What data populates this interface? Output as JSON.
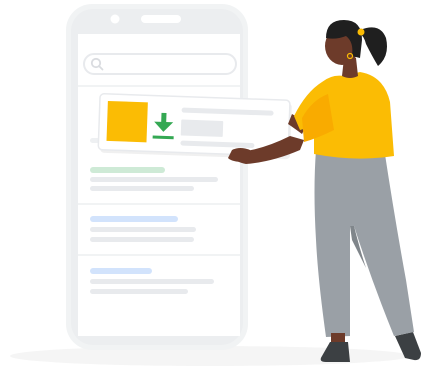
{
  "scene": {
    "kind": "illustration",
    "palette": {
      "background": "#ffffff",
      "phone_body": "#f1f3f4",
      "phone_frame": "#e8eaed",
      "phone_screen": "#ffffff",
      "placeholder_line": "#e8eaed",
      "link_green": "#ceead6",
      "link_blue": "#d2e3fc",
      "accent_yellow": "#fbbc04",
      "download_green": "#34a853",
      "skin": "#6d3b2a",
      "hair": "#1f1f1f",
      "shirt": "#fbbc04",
      "pants": "#9aa0a6",
      "shoe": "#3c4043"
    }
  },
  "phone": {
    "camera_icon": "camera-dot-icon",
    "speaker_icon": "speaker-bar-icon",
    "search_icon": "search-icon",
    "results": [
      {
        "title_color": "green"
      },
      {
        "title_color": "blue"
      },
      {
        "title_color": "blue"
      }
    ]
  },
  "card": {
    "thumbnail_color": "#fbbc04",
    "action_icon": "download-icon"
  }
}
